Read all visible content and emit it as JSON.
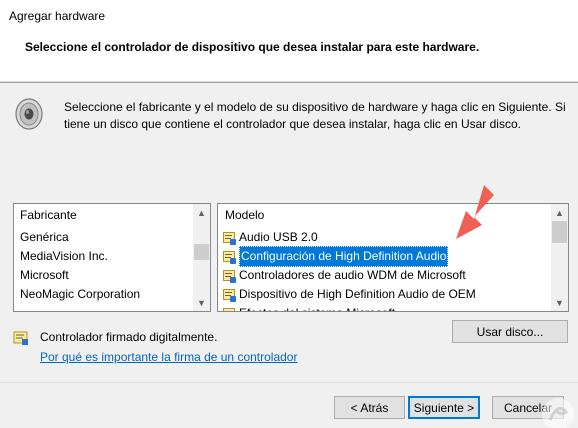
{
  "window": {
    "title": "Agregar hardware"
  },
  "header": {
    "subtitle": "Seleccione el controlador de dispositivo que desea instalar para este hardware."
  },
  "description": {
    "line1": "Seleccione el fabricante y el modelo de su dispositivo de hardware y haga clic en Siguiente. Si",
    "line2": "tiene un disco que contiene el controlador que desea instalar, haga clic en  Usar disco."
  },
  "manufacturer_list": {
    "header": "Fabricante",
    "items": [
      "Genérica",
      "MediaVision Inc.",
      "Microsoft",
      "NeoMagic Corporation"
    ]
  },
  "model_list": {
    "header": "Modelo",
    "items": [
      "Audio USB 2.0",
      "Configuración de High Definition Audio",
      "Controladores de audio WDM de Microsoft",
      "Dispositivo de High Definition Audio de OEM",
      "Efectos del sistema Microsoft"
    ],
    "selected_index": 1
  },
  "signed": {
    "text": "Controlador firmado digitalmente."
  },
  "link": {
    "text": "Por qué es importante la firma de un controlador"
  },
  "buttons": {
    "have_disk": "Usar disco...",
    "back": "< Atrás",
    "next": "Siguiente >",
    "cancel": "Cancelar"
  },
  "icons": {
    "speaker": "speaker-icon",
    "driver": "driver-icon",
    "signed": "signed-driver-icon",
    "annotation": "red-arrow-icon"
  },
  "colors": {
    "selection": "#0078d7",
    "link": "#0066cc",
    "annotation_arrow": "#f0574c"
  }
}
